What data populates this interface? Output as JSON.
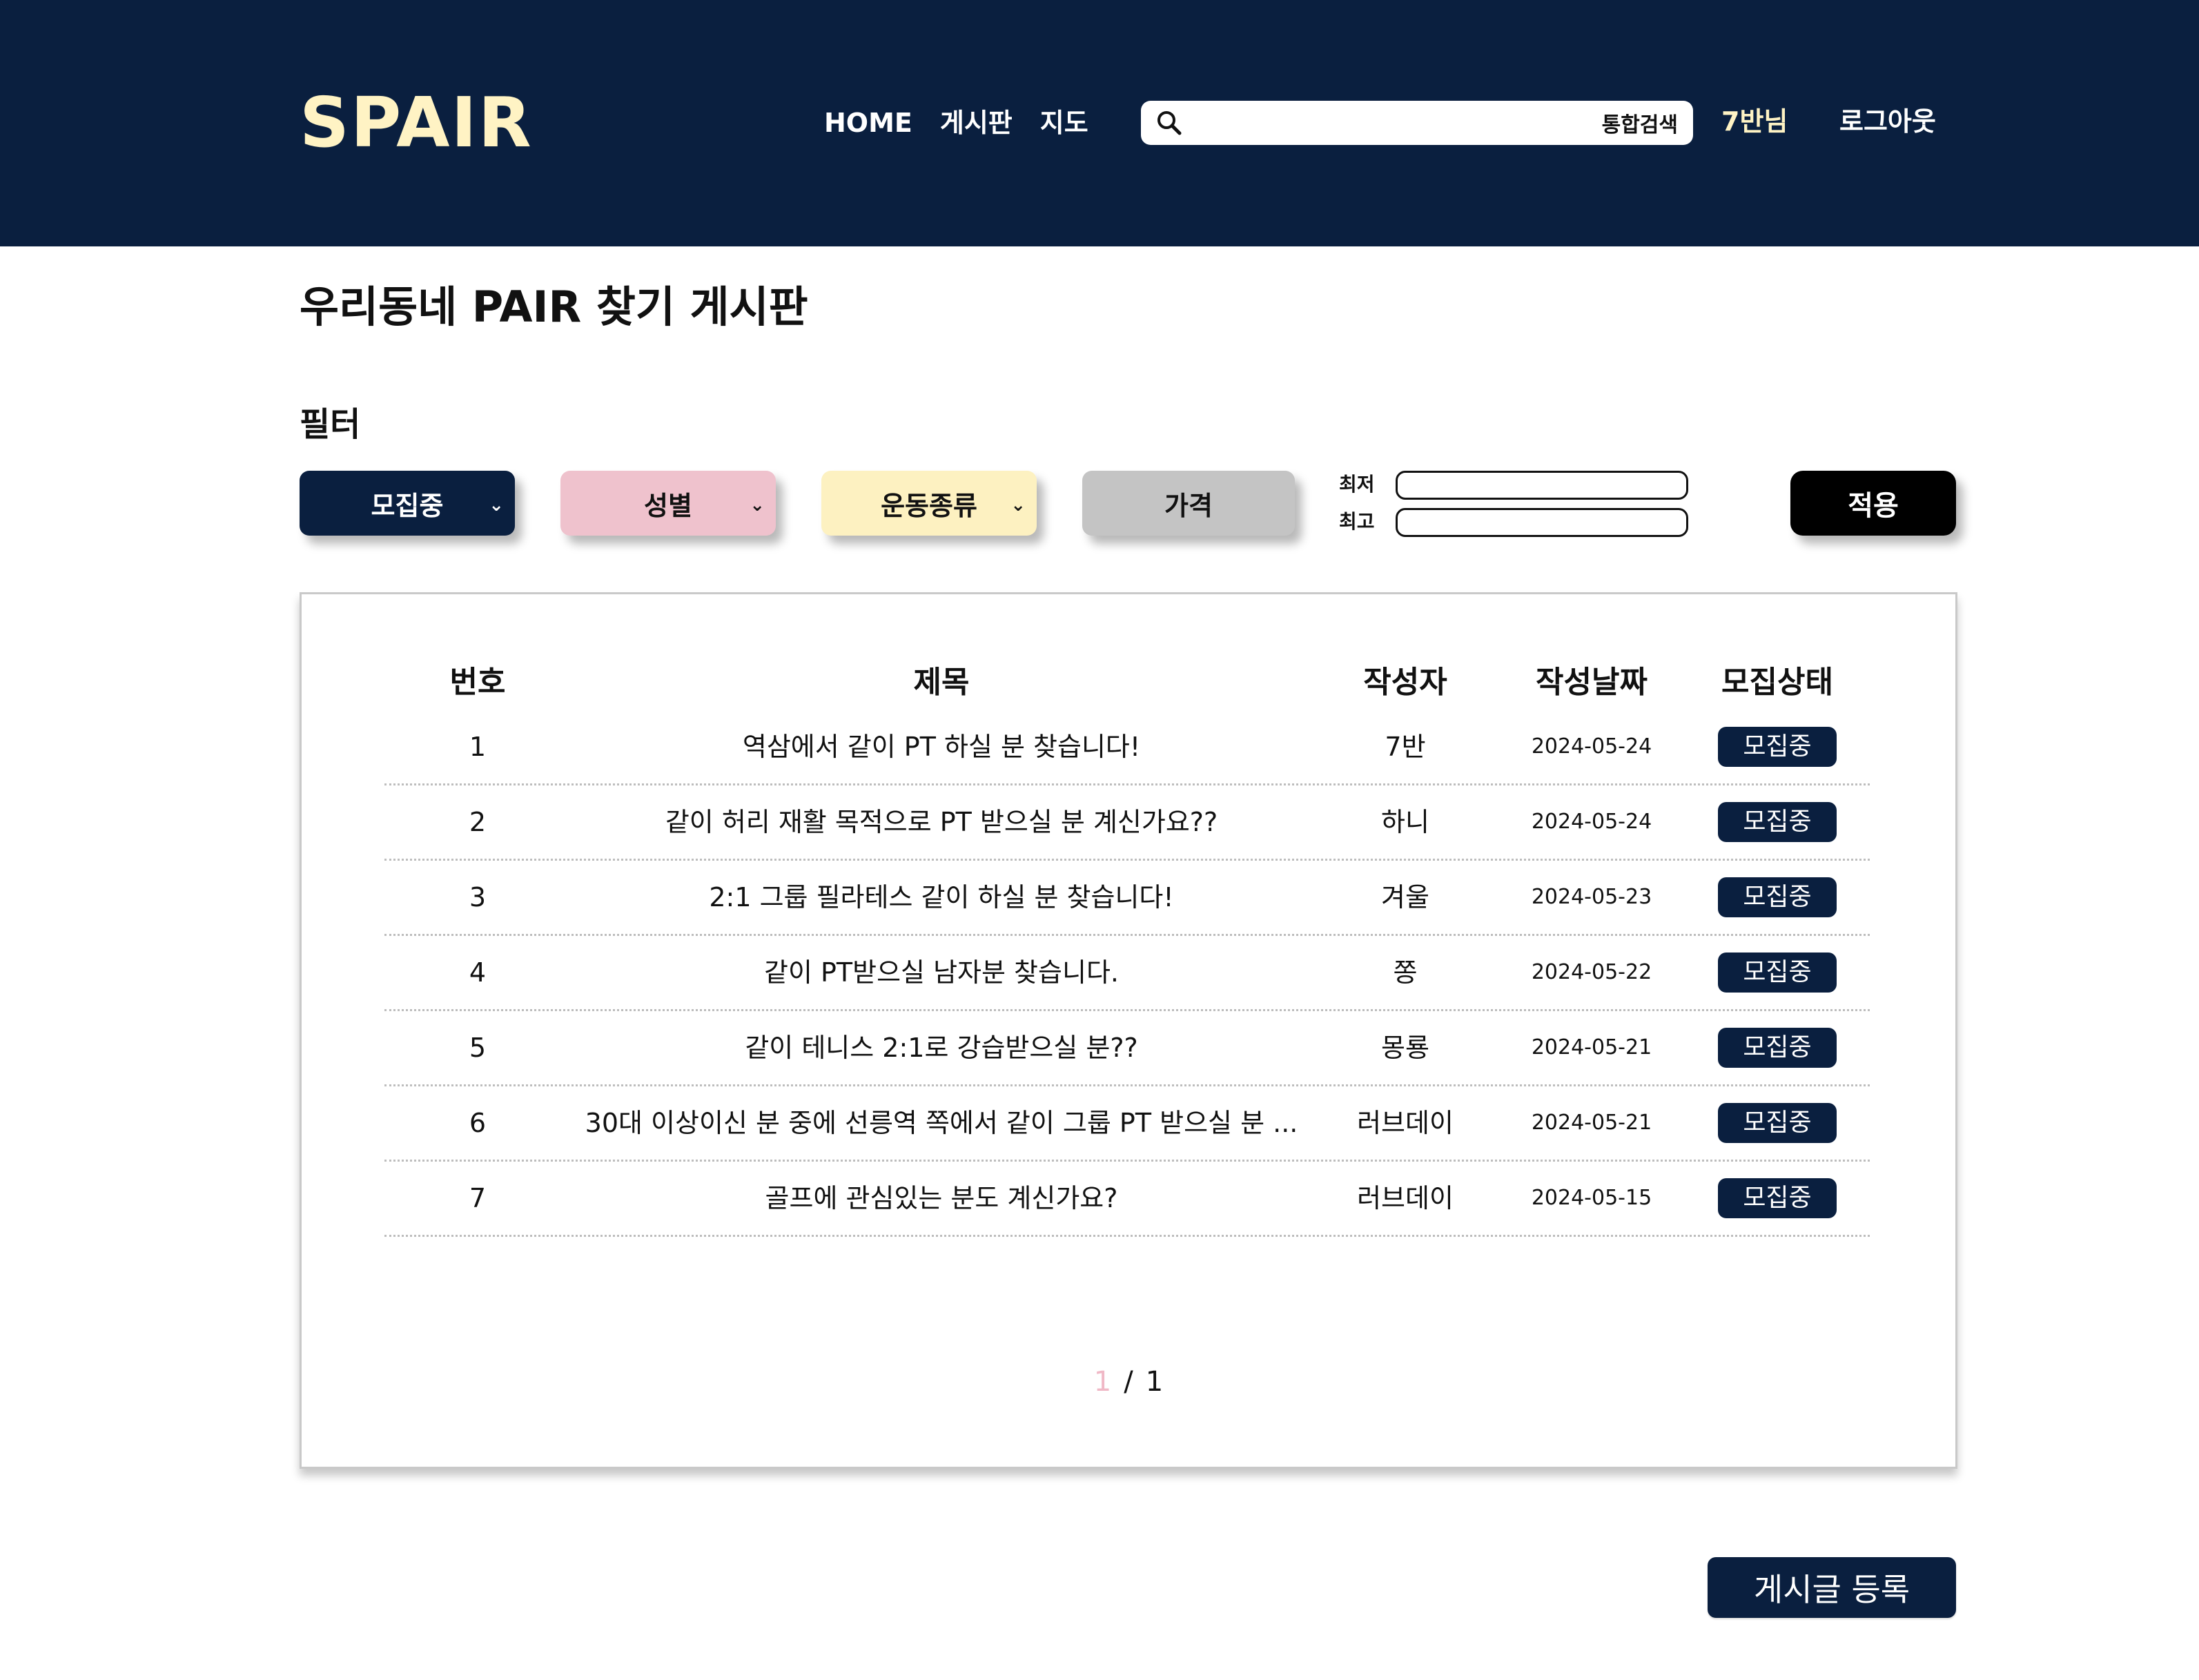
{
  "header": {
    "logo": "SPAIR",
    "nav": [
      "HOME",
      "게시판",
      "지도"
    ],
    "search": {
      "placeholder": "",
      "button_label": "통합검색"
    },
    "user_label": "7반님",
    "logout_label": "로그아웃"
  },
  "page": {
    "title": "우리동네 PAIR 찾기 게시판"
  },
  "filter": {
    "label": "필터",
    "status_label": "모집중",
    "gender_label": "성별",
    "sport_label": "운동종류",
    "price_label": "가격",
    "min_label": "최저",
    "max_label": "최고",
    "apply_label": "적용"
  },
  "table": {
    "headers": [
      "번호",
      "제목",
      "작성자",
      "작성날짜",
      "모집상태"
    ],
    "rows": [
      {
        "num": "1",
        "title": "역삼에서 같이 PT 하실 분 찾습니다!",
        "author": "7반",
        "date": "2024-05-24",
        "status": "모집중"
      },
      {
        "num": "2",
        "title": "같이 허리 재활 목적으로 PT 받으실 분 계신가요??",
        "author": "하니",
        "date": "2024-05-24",
        "status": "모집중"
      },
      {
        "num": "3",
        "title": "2:1 그룹 필라테스 같이 하실 분 찾습니다!",
        "author": "겨울",
        "date": "2024-05-23",
        "status": "모집중"
      },
      {
        "num": "4",
        "title": "같이 PT받으실 남자분 찾습니다.",
        "author": "쫑",
        "date": "2024-05-22",
        "status": "모집중"
      },
      {
        "num": "5",
        "title": "같이 테니스 2:1로 강습받으실 분??",
        "author": "몽룡",
        "date": "2024-05-21",
        "status": "모집중"
      },
      {
        "num": "6",
        "title": "30대 이상이신 분 중에 선릉역 쪽에서 같이 그룹 PT 받으실 분 ...",
        "author": "러브데이",
        "date": "2024-05-21",
        "status": "모집중"
      },
      {
        "num": "7",
        "title": "골프에 관심있는 분도 계신가요?",
        "author": "러브데이",
        "date": "2024-05-15",
        "status": "모집중"
      }
    ]
  },
  "pagination": {
    "current": "1",
    "separator": "/",
    "total": "1"
  },
  "actions": {
    "register_label": "게시글 등록"
  },
  "colors": {
    "navy": "#0a1f3f",
    "cream": "#fff3c4",
    "pink": "#efc2cd",
    "yellow": "#fdf1c1",
    "gray": "#c4c4c4"
  }
}
